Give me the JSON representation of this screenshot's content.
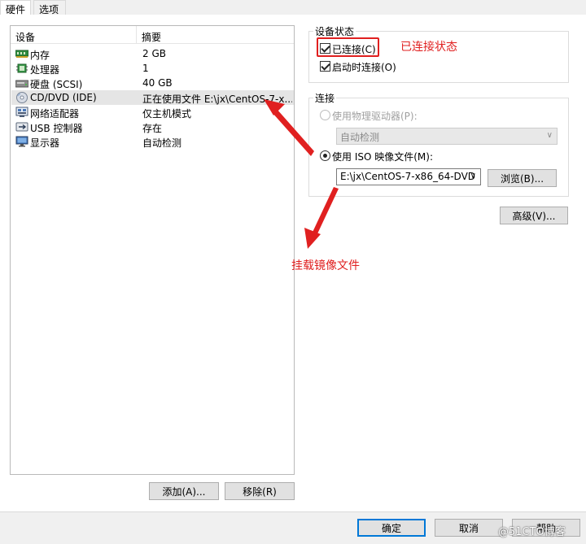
{
  "tabs": [
    {
      "label": "硬件"
    },
    {
      "label": "选项"
    }
  ],
  "device_list": {
    "col_device": "设备",
    "col_summary": "摘要",
    "rows": [
      {
        "name": "内存",
        "summary": "2 GB",
        "icon": "memory-icon"
      },
      {
        "name": "处理器",
        "summary": "1",
        "icon": "cpu-icon"
      },
      {
        "name": "硬盘 (SCSI)",
        "summary": "40 GB",
        "icon": "hard-disk-icon"
      },
      {
        "name": "CD/DVD (IDE)",
        "summary": "正在使用文件 E:\\jx\\CentOS-7-x...",
        "icon": "cd-dvd-icon"
      },
      {
        "name": "网络适配器",
        "summary": "仅主机模式",
        "icon": "network-adapter-icon"
      },
      {
        "name": "USB 控制器",
        "summary": "存在",
        "icon": "usb-icon"
      },
      {
        "name": "显示器",
        "summary": "自动检测",
        "icon": "monitor-icon"
      }
    ],
    "add_label": "添加(A)...",
    "remove_label": "移除(R)"
  },
  "device_status": {
    "title": "设备状态",
    "connected_label": "已连接(C)",
    "connected_checked": true,
    "connect_on_start_label": "启动时连接(O)",
    "connect_on_start_checked": true
  },
  "connection": {
    "title": "连接",
    "physical_label": "使用物理驱动器(P):",
    "physical_value": "自动检测",
    "iso_label": "使用 ISO 映像文件(M):",
    "iso_value": "E:\\jx\\CentOS-7-x86_64-DVD",
    "browse_label": "浏览(B)..."
  },
  "advanced_label": "高级(V)...",
  "footer": {
    "ok_label": "确定",
    "cancel_label": "取消",
    "help_label": "帮助"
  },
  "annotations": {
    "status_note": "已连接状态",
    "mount_note": "挂载镜像文件"
  },
  "watermark": "@51CTO博客",
  "colors": {
    "annotation_red": "#e02020",
    "selection_gray": "#e5e5e5",
    "primary_border": "#0078d7"
  }
}
